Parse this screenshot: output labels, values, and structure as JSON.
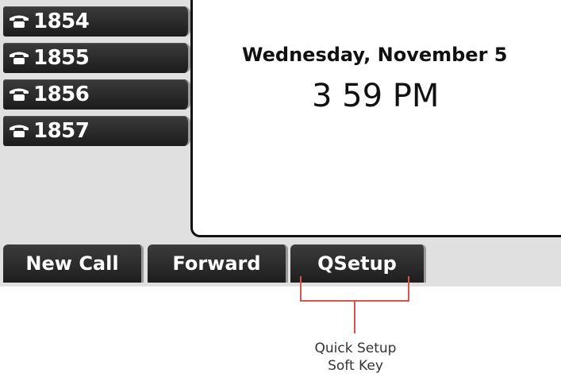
{
  "line_keys": [
    {
      "number": "1854",
      "icon": "phone-handset-icon"
    },
    {
      "number": "1855",
      "icon": "phone-handset-icon"
    },
    {
      "number": "1856",
      "icon": "phone-handset-icon"
    },
    {
      "number": "1857",
      "icon": "phone-handset-icon"
    }
  ],
  "status": {
    "date": "Wednesday, November 5",
    "time": "3 59 PM"
  },
  "soft_keys": {
    "new_call": "New Call",
    "forward": "Forward",
    "qsetup": "QSetup"
  },
  "callout": {
    "line1": "Quick Setup",
    "line2": "Soft Key",
    "color": "#d9534f"
  }
}
